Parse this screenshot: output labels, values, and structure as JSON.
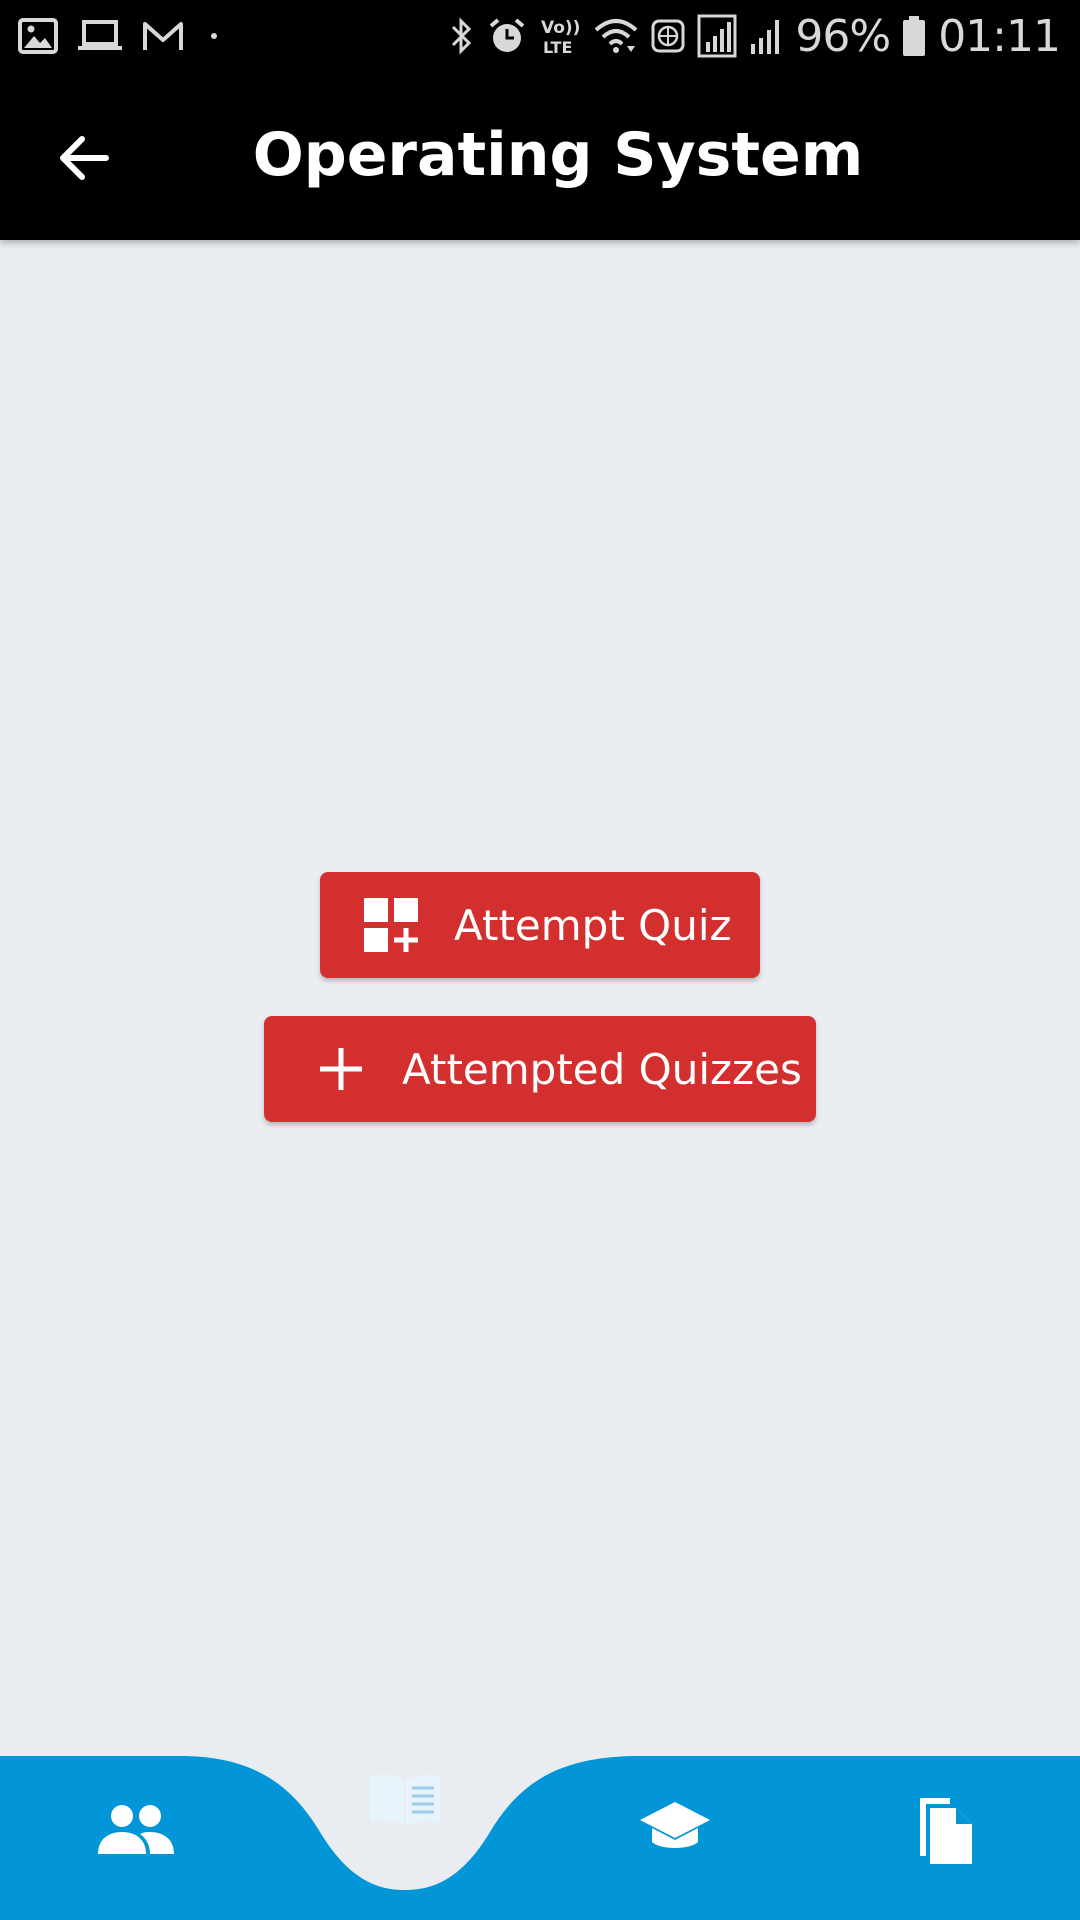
{
  "status_bar": {
    "left_icons": [
      "gallery-icon",
      "laptop-icon",
      "gmail-icon",
      "dot-icon"
    ],
    "right_icons": [
      "bluetooth-icon",
      "alarm-icon",
      "volte-icon",
      "wifi-icon",
      "globe-icon",
      "signal-sim1-icon",
      "signal-sim2-icon",
      "battery-icon"
    ],
    "battery_percent": "96%",
    "time": "01:11"
  },
  "app_bar": {
    "title": "Operating System",
    "back_icon": "arrow-left-icon"
  },
  "main": {
    "attempt_quiz_label": "Attempt Quiz",
    "attempt_quiz_icon": "dashboard-add-icon",
    "attempted_quizzes_label": "Attempted Quizzes",
    "attempted_quizzes_icon": "plus-icon"
  },
  "bottom_nav": {
    "items": [
      {
        "icon": "people-icon"
      },
      {
        "icon": "book-icon",
        "selected": true
      },
      {
        "icon": "graduation-cap-icon"
      },
      {
        "icon": "documents-icon"
      }
    ],
    "bar_color": "#0296d8",
    "active_icon_color": "#e8f4fb"
  },
  "colors": {
    "background": "#e9edf1",
    "accent": "#d32f2f",
    "header": "#000000"
  }
}
